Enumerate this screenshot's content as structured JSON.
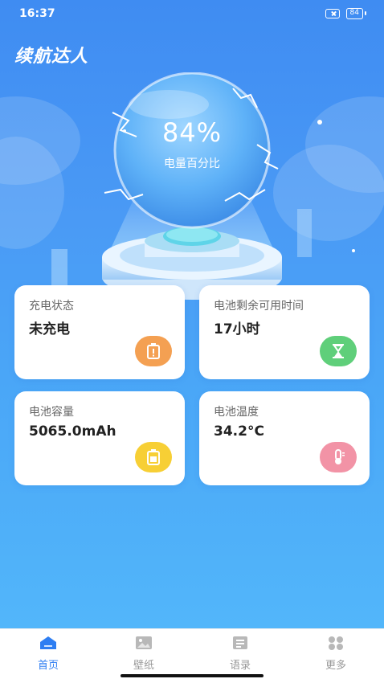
{
  "status_bar": {
    "time": "16:37",
    "battery": "84"
  },
  "app": {
    "title": "续航达人"
  },
  "battery_orb": {
    "percent": "84%",
    "label": "电量百分比"
  },
  "cards": [
    {
      "label": "充电状态",
      "value": "未充电",
      "icon": "battery-alert-icon",
      "color": "#f4a052"
    },
    {
      "label": "电池剩余可用时间",
      "value": "17小时",
      "icon": "hourglass-icon",
      "color": "#5fcf7a"
    },
    {
      "label": "电池容量",
      "value": "5065.0mAh",
      "icon": "battery-icon",
      "color": "#f7cf35"
    },
    {
      "label": "电池温度",
      "value": "34.2°C",
      "icon": "thermometer-icon",
      "color": "#f293a6"
    }
  ],
  "nav": [
    {
      "label": "首页",
      "icon": "home-icon",
      "active": true
    },
    {
      "label": "壁纸",
      "icon": "wallpaper-icon",
      "active": false
    },
    {
      "label": "语录",
      "icon": "quotes-icon",
      "active": false
    },
    {
      "label": "更多",
      "icon": "more-grid-icon",
      "active": false
    }
  ],
  "colors": {
    "accent": "#2e7ef2",
    "background_top": "#3f8cf2",
    "background_bottom": "#52b6fa"
  }
}
